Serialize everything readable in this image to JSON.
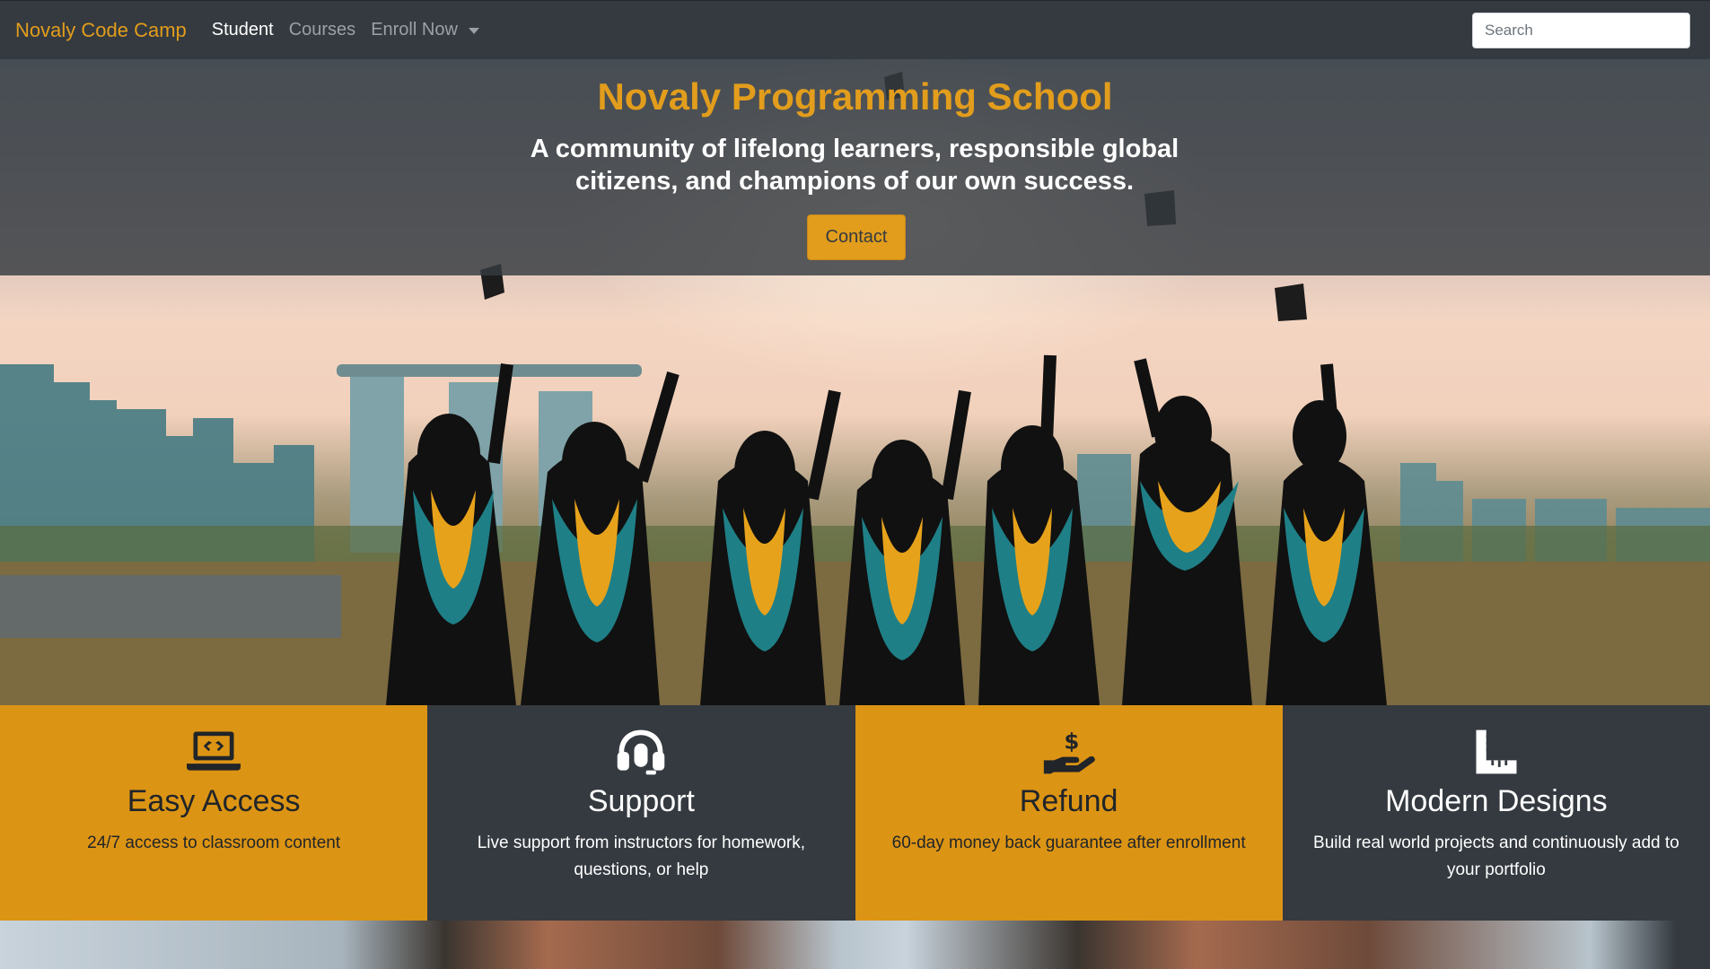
{
  "navbar": {
    "brand": "Novaly Code Camp",
    "links": [
      "Student",
      "Courses",
      "Enroll Now"
    ],
    "search_placeholder": "Search"
  },
  "hero": {
    "title": "Novaly Programming School",
    "subtitle": "A community of lifelong learners, responsible global citizens, and champions of our own success.",
    "button_label": "Contact"
  },
  "features": [
    {
      "icon": "laptop-code-icon",
      "title": "Easy Access",
      "text": "24/7 access to classroom content"
    },
    {
      "icon": "headset-icon",
      "title": "Support",
      "text": "Live support from instructors for homework, questions, or help"
    },
    {
      "icon": "hand-holding-usd-icon",
      "title": "Refund",
      "text": "60-day money back guarantee after enrollment"
    },
    {
      "icon": "ruler-combined-icon",
      "title": "Modern Designs",
      "text": "Build real world projects and continuously add to your portfolio"
    }
  ],
  "colors": {
    "accent": "#e29d1c",
    "dark": "#343a40",
    "card_gold": "#dc9414"
  }
}
